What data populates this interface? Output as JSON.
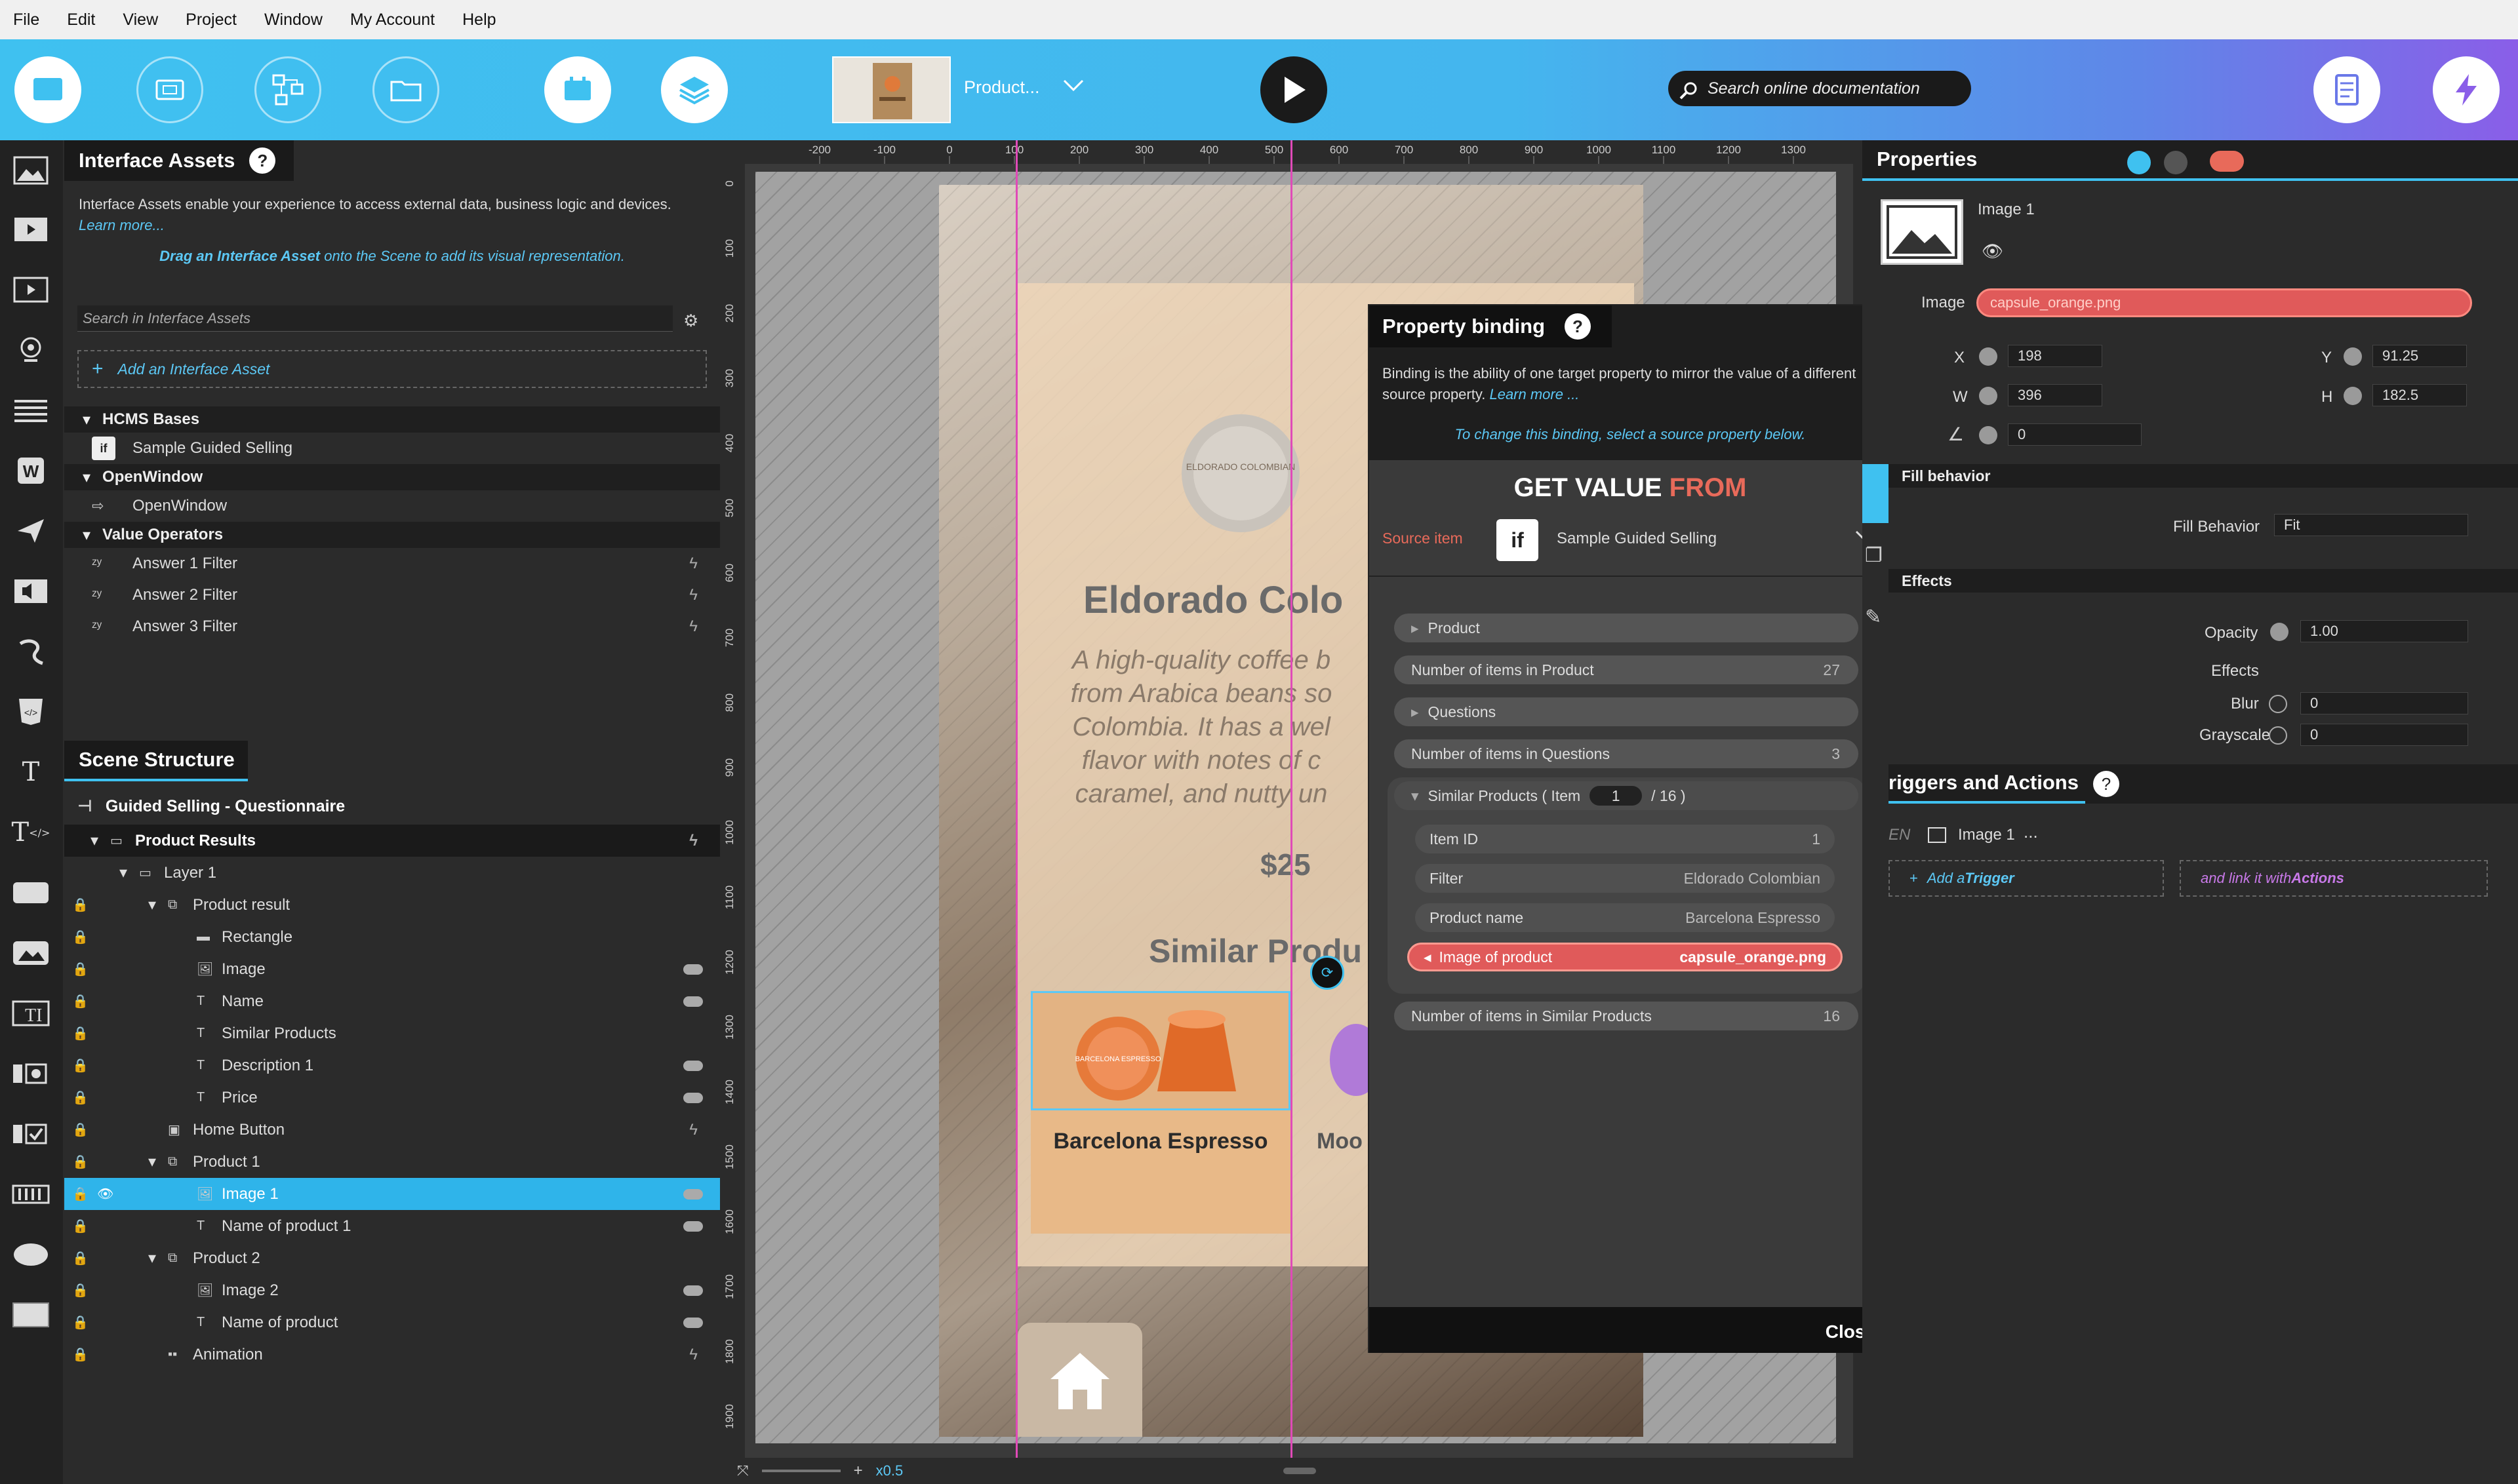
{
  "menu": [
    "File",
    "Edit",
    "View",
    "Project",
    "Window",
    "My Account",
    "Help"
  ],
  "toolbar": {
    "product_label": "Product...",
    "search_placeholder": "Search online documentation"
  },
  "interface_assets": {
    "title": "Interface Assets",
    "help": "?",
    "desc": "Interface Assets enable your experience to access external data, business logic and devices.",
    "learn": "Learn more...",
    "drag_hint_strong": "Drag an Interface Asset",
    "drag_hint_rest": " onto the Scene to add its visual representation.",
    "search_placeholder": "Search in Interface Assets",
    "add": "Add an Interface Asset",
    "sections": [
      {
        "title": "HCMS Bases",
        "items": [
          "Sample Guided Selling"
        ]
      },
      {
        "title": "OpenWindow",
        "items": [
          "OpenWindow"
        ]
      },
      {
        "title": "Value Operators",
        "items": [
          "Answer 1 Filter",
          "Answer 2 Filter",
          "Answer 3 Filter"
        ]
      }
    ]
  },
  "scene": {
    "title": "Scene Structure",
    "root": "Guided Selling - Questionnaire",
    "items": [
      {
        "label": "Product Results",
        "indent": 0,
        "bold": true
      },
      {
        "label": "Layer 1",
        "indent": 1
      },
      {
        "label": "Product result",
        "indent": 2
      },
      {
        "label": "Rectangle",
        "indent": 3
      },
      {
        "label": "Image",
        "indent": 3
      },
      {
        "label": "Name",
        "indent": 3
      },
      {
        "label": "Similar Products",
        "indent": 3
      },
      {
        "label": "Description 1",
        "indent": 3
      },
      {
        "label": "Price",
        "indent": 3
      },
      {
        "label": "Home Button",
        "indent": 2
      },
      {
        "label": "Product 1",
        "indent": 2
      },
      {
        "label": "Image 1",
        "indent": 3,
        "selected": true
      },
      {
        "label": "Name of product 1",
        "indent": 3
      },
      {
        "label": "Product 2",
        "indent": 2
      },
      {
        "label": "Image 2",
        "indent": 3
      },
      {
        "label": "Name of product",
        "indent": 3
      },
      {
        "label": "Animation",
        "indent": 2
      }
    ]
  },
  "ruler": {
    "h": [
      "-200",
      "-100",
      "0",
      "100",
      "200",
      "300",
      "400",
      "500",
      "600",
      "700",
      "800",
      "900",
      "1000",
      "1100",
      "1200",
      "1300"
    ],
    "v": [
      "0",
      "100",
      "200",
      "300",
      "400",
      "500",
      "600",
      "700",
      "800",
      "900",
      "1000",
      "1100",
      "1200",
      "1300",
      "1400",
      "1500",
      "1600",
      "1700",
      "1800",
      "1900"
    ]
  },
  "canvas": {
    "title": "Eldorado Colo",
    "desc": "A high-quality coffee b from Arabica beans so Colombia. It has a wel flavor with notes of c caramel, and nutty un",
    "price": "$25",
    "similar": "Similar Produ",
    "p1": "Barcelona Espresso",
    "p2": "Moo",
    "zoom": "x0.5",
    "capsule_text": "BARCELONA ESPRESSO",
    "capsule_text2": "ELDORADO COLOMBIAN"
  },
  "binding": {
    "title": "Property binding",
    "help": "?",
    "desc": "Binding is the ability of one target property to mirror the value of a different source property.",
    "learn": "Learn more ...",
    "hint": "To change this binding, select a source property below.",
    "get": "GET VALUE",
    "from": "FROM",
    "source_label": "Source item",
    "source": "Sample Guided Selling",
    "rows": [
      {
        "label": "Product"
      },
      {
        "label": "Number of items in Product",
        "value": "27"
      },
      {
        "label": "Questions"
      },
      {
        "label": "Number of items in Questions",
        "value": "3"
      }
    ],
    "similar": {
      "label": "Similar Products",
      "item_word": "( Item",
      "item": "1",
      "total": "/ 16 )"
    },
    "sub": [
      {
        "label": "Item ID",
        "value": "1"
      },
      {
        "label": "Filter",
        "value": "Eldorado Colombian"
      },
      {
        "label": "Product name",
        "value": "Barcelona Espresso"
      },
      {
        "label": "Image of product",
        "value": "capsule_orange.png"
      }
    ],
    "last": {
      "label": "Number of items in Similar Products",
      "value": "16"
    },
    "close": "Close"
  },
  "properties": {
    "title": "Properties",
    "name": "Image 1",
    "image_label": "Image",
    "image_value": "capsule_orange.png",
    "x_label": "X",
    "x": "198",
    "y_label": "Y",
    "y": "91.25",
    "w_label": "W",
    "w": "396",
    "h_label": "H",
    "h": "182.5",
    "angle": "0",
    "fill_title": "Fill behavior",
    "fill_label": "Fill Behavior",
    "fill_value": "Fit",
    "effects_title": "Effects",
    "opacity_label": "Opacity",
    "opacity": "1.00",
    "effects_label": "Effects",
    "blur_label": "Blur",
    "blur": "0",
    "gray_label": "Grayscale",
    "gray": "0"
  },
  "triggers": {
    "title": "riggers and Actions",
    "help": "?",
    "when": "EN",
    "item": "Image 1",
    "dots": "...",
    "add_word": "Add a ",
    "add_strong": "Trigger",
    "link_word": "and link it with ",
    "link_strong": "Actions"
  },
  "colors": {
    "accent": "#3fc1f0",
    "binding_red": "#e05a5a",
    "selected_row": "#2fb4ea"
  }
}
